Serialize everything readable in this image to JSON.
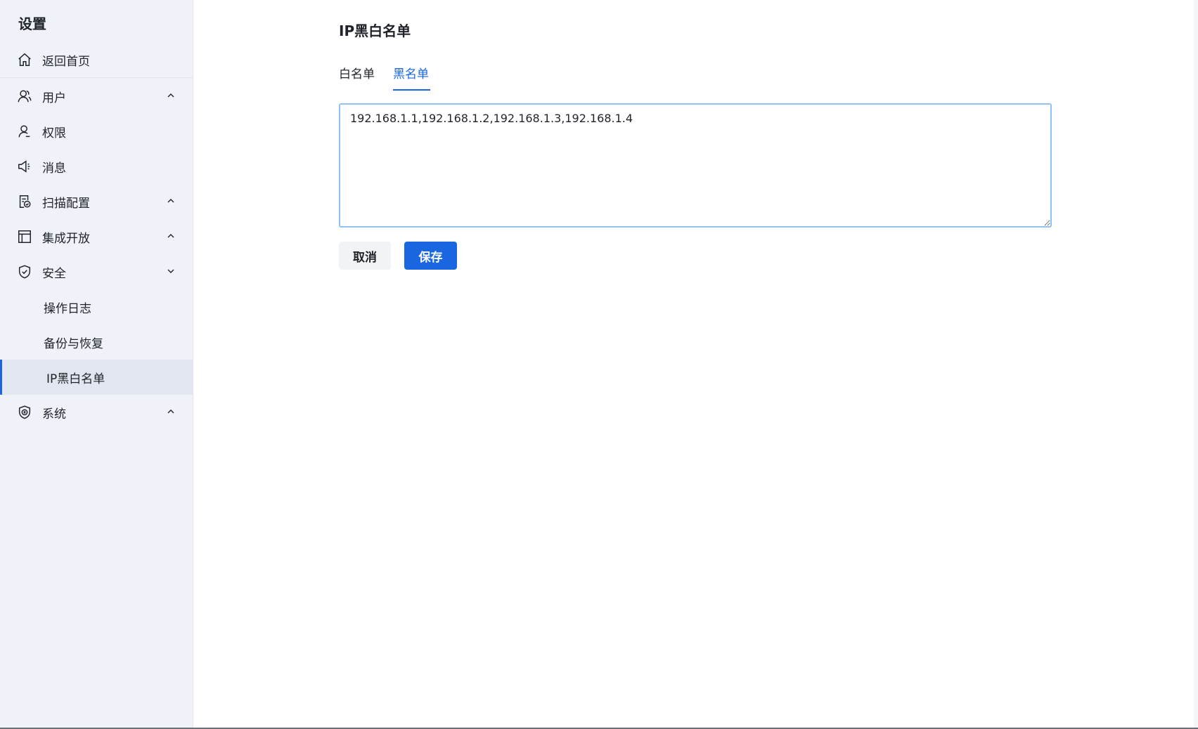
{
  "sidebar": {
    "title": "设置",
    "items": [
      {
        "label": "返回首页",
        "icon": "home-icon"
      },
      {
        "label": "用户",
        "icon": "users-icon",
        "chevron": "up"
      },
      {
        "label": "权限",
        "icon": "user-icon"
      },
      {
        "label": "消息",
        "icon": "megaphone-icon"
      },
      {
        "label": "扫描配置",
        "icon": "scan-doc-icon",
        "chevron": "up"
      },
      {
        "label": "集成开放",
        "icon": "layout-icon",
        "chevron": "up"
      },
      {
        "label": "安全",
        "icon": "shield-check-icon",
        "chevron": "down"
      },
      {
        "label": "操作日志"
      },
      {
        "label": "备份与恢复"
      },
      {
        "label": "IP黑白名单",
        "active": true
      },
      {
        "label": "系统",
        "icon": "shield-cert-icon",
        "chevron": "up"
      }
    ]
  },
  "main": {
    "title": "IP黑白名单",
    "tabs": [
      {
        "label": "白名单"
      },
      {
        "label": "黑名单",
        "active": true
      }
    ],
    "textarea_value": "192.168.1.1,192.168.1.2,192.168.1.3,192.168.1.4",
    "cancel_label": "取消",
    "save_label": "保存"
  },
  "colors": {
    "accent": "#1a66e0",
    "sidebar_bg": "#eff2f9",
    "active_item_bg": "#e1e6ef",
    "textarea_border": "#8fc3f3"
  }
}
